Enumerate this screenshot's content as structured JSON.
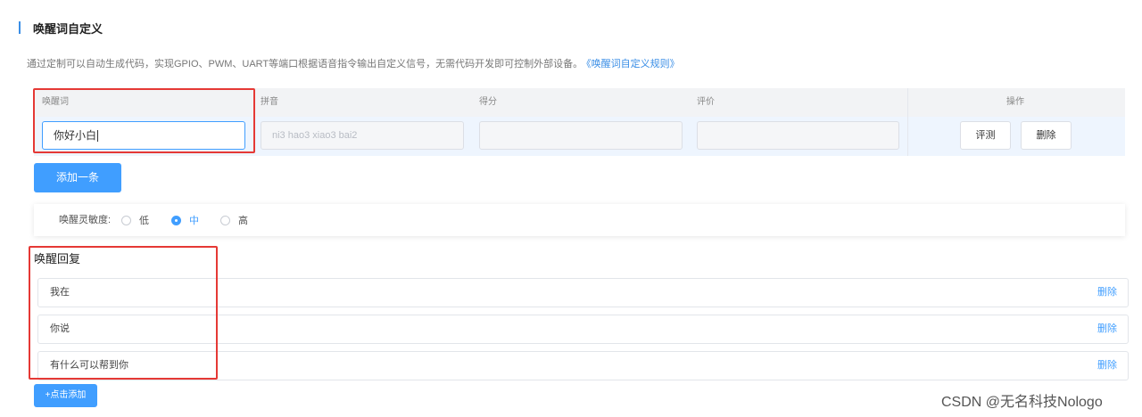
{
  "section": {
    "title": "唤醒词自定义",
    "description": "通过定制可以自动生成代码，实现GPIO、PWM、UART等端口根据语音指令输出自定义信号，无需代码开发即可控制外部设备。",
    "rules_link": "《唤醒词自定义规则》"
  },
  "table": {
    "headers": {
      "wake_word": "唤醒词",
      "pinyin": "拼音",
      "score": "得分",
      "rating": "评价",
      "operation": "操作"
    },
    "row": {
      "wake_word_value": "你好小白",
      "pinyin_value": "ni3 hao3 xiao3 bai2",
      "score_value": "",
      "rating_value": "",
      "evaluate_label": "评测",
      "delete_label": "删除"
    }
  },
  "add_row_label": "添加一条",
  "sensitivity": {
    "label": "唤醒灵敏度:",
    "options": [
      "低",
      "中",
      "高"
    ],
    "selected": "中"
  },
  "replies": {
    "title": "唤醒回复",
    "items": [
      {
        "text": "我在",
        "delete_label": "删除"
      },
      {
        "text": "你说",
        "delete_label": "删除"
      },
      {
        "text": "有什么可以帮到你",
        "delete_label": "删除"
      }
    ],
    "add_label": "+点击添加"
  },
  "watermark": "CSDN @无名科技Nologo",
  "colors": {
    "accent": "#409eff",
    "highlight_box": "#e53935",
    "table_header_bg": "#f2f3f5",
    "table_row_bg": "#eef5fe"
  }
}
